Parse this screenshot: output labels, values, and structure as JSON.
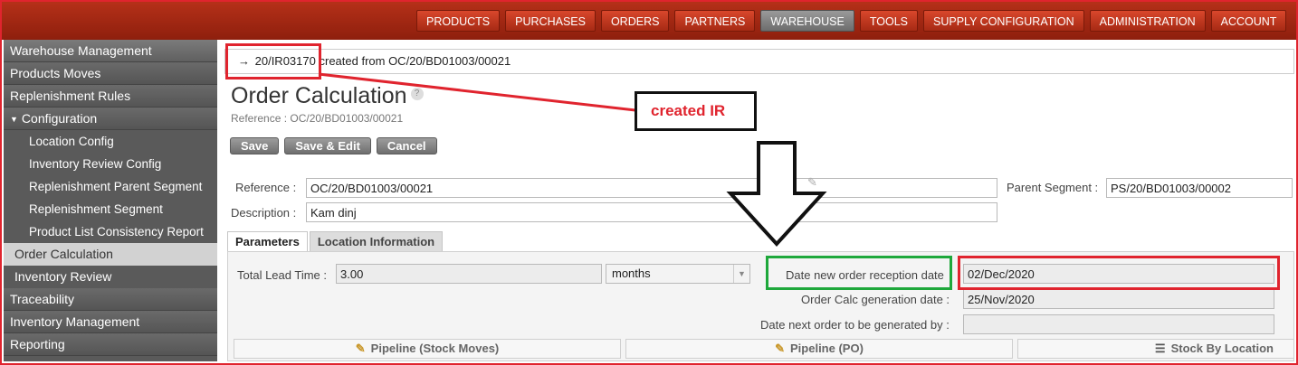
{
  "topnav": [
    "PRODUCTS",
    "PURCHASES",
    "ORDERS",
    "PARTNERS",
    "WAREHOUSE",
    "TOOLS",
    "SUPPLY CONFIGURATION",
    "ADMINISTRATION",
    "ACCOUNT"
  ],
  "sidebar": {
    "warehouse_mgmt": "Warehouse Management",
    "products_moves": "Products Moves",
    "replenishment_rules": "Replenishment Rules",
    "configuration": "Configuration",
    "location_config": "Location Config",
    "inventory_review_config": "Inventory Review Config",
    "replenishment_parent_segment": "Replenishment Parent Segment",
    "replenishment_segment": "Replenishment Segment",
    "product_list_consistency": "Product List Consistency Report",
    "order_calculation": "Order Calculation",
    "inventory_review": "Inventory Review",
    "traceability": "Traceability",
    "inventory_management": "Inventory Management",
    "reporting": "Reporting"
  },
  "notice": {
    "arrow": "→",
    "link": "20/IR03170",
    "text": "created from OC/20/BD01003/00021"
  },
  "page": {
    "title": "Order Calculation",
    "help": "?",
    "reference_sub": "Reference : OC/20/BD01003/00021"
  },
  "buttons": {
    "save": "Save",
    "save_edit": "Save & Edit",
    "cancel": "Cancel"
  },
  "form": {
    "reference_label": "Reference :",
    "reference_value": "OC/20/BD01003/00021",
    "description_label": "Description :",
    "description_value": "Kam dinj",
    "parent_segment_label": "Parent Segment :",
    "parent_segment_value": "PS/20/BD01003/00002"
  },
  "tabs": {
    "parameters": "Parameters",
    "location_info": "Location Information"
  },
  "params": {
    "lead_time_label": "Total Lead Time :",
    "lead_time_value": "3.00",
    "lead_time_unit": "months",
    "reception_date_label": "Date new order reception date",
    "reception_date_value": "02/Dec/2020",
    "gen_date_label": "Order Calc generation date :",
    "gen_date_value": "25/Nov/2020",
    "next_order_label": "Date next order to be generated by :",
    "next_order_value": ""
  },
  "tools": {
    "pipeline_stock": "Pipeline (Stock Moves)",
    "pipeline_po": "Pipeline (PO)",
    "stock_by_location": "Stock By Location"
  },
  "annotation": {
    "callout": "created IR"
  },
  "colors": {
    "highlight_red": "#e0242e",
    "highlight_green": "#1ea83b",
    "nav_red": "#a62a14"
  }
}
